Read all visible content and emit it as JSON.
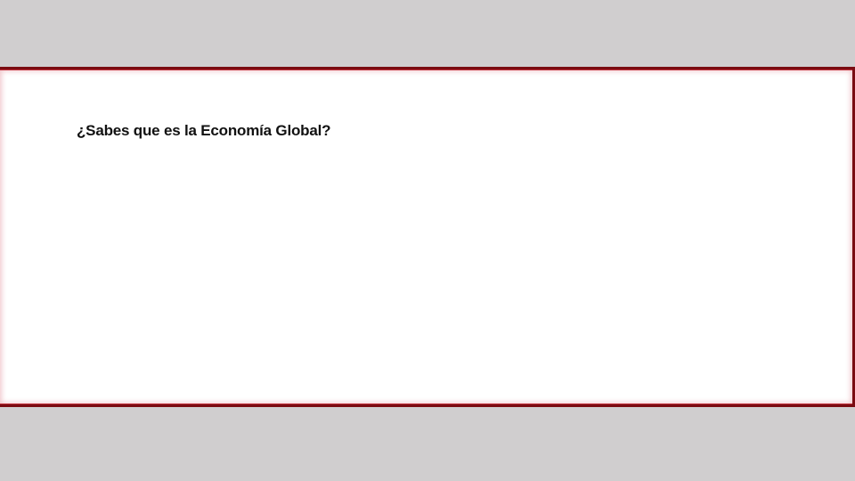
{
  "slide": {
    "question": "¿Sabes que es la Economía Global?"
  },
  "colors": {
    "background": "#d0cecf",
    "panel": "#ffffff",
    "border": "#7a0c12",
    "text": "#111111"
  }
}
